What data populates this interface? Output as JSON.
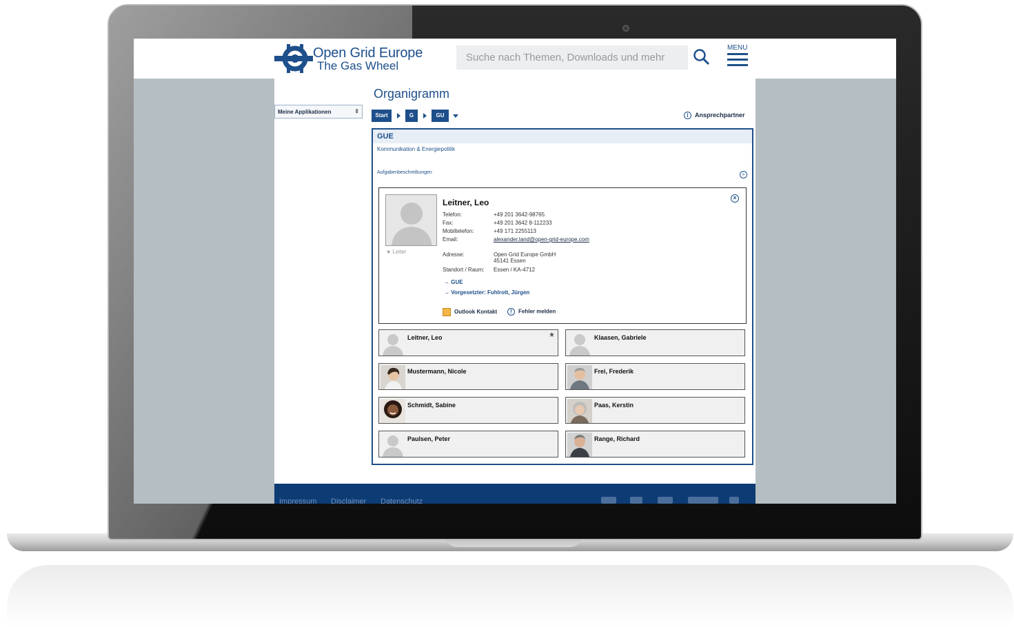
{
  "brand": {
    "line1": "Open Grid Europe",
    "line2": "The Gas Wheel",
    "color": "#1d4f8a"
  },
  "header": {
    "search_placeholder": "Suche nach Themen, Downloads und mehr",
    "menu_label": "MENU"
  },
  "sidebar": {
    "apps_select": "Meine Applikationen"
  },
  "page": {
    "title": "Organigramm",
    "breadcrumb": [
      "Start",
      "G",
      "GU"
    ],
    "contact_link": "Ansprechpartner"
  },
  "unit": {
    "code": "GUE",
    "name": "Kommunikation & Energiepolitik",
    "tasks_link": "Aufgabenbeschreibungen"
  },
  "detail": {
    "name": "Leitner, Leo",
    "role_tag": "Leiter",
    "fields": {
      "phone_label": "Telefon:",
      "phone": "+49 201 3642-98765",
      "fax_label": "Fax:",
      "fax": "+49 201 3642 8-112233",
      "mobile_label": "Mobiltelefon:",
      "mobile": "+49 171 2255113",
      "email_label": "Email:",
      "email": "alexander.land@open-grid-europe.com",
      "address_label": "Adresse:",
      "address_line1": "Open Grid Europe GmbH",
      "address_line2": "45141 Essen",
      "location_label": "Standort / Raum:",
      "location": "Essen / KA-4712"
    },
    "links": {
      "unit": "GUE",
      "supervisor": "Vorgesetzter: Fuhlrott, Jürgen"
    },
    "actions": {
      "outlook": "Outlook Kontakt",
      "report": "Fehler melden"
    }
  },
  "members": [
    {
      "name": "Leitner, Leo",
      "photo": "placeholder-silhouette",
      "lead": true
    },
    {
      "name": "Klaasen, Gabriele",
      "photo": "placeholder-silhouette",
      "lead": false
    },
    {
      "name": "Mustermann, Nicole",
      "photo": "portrait",
      "lead": false
    },
    {
      "name": "Frei, Frederik",
      "photo": "portrait",
      "lead": false
    },
    {
      "name": "Schmidt, Sabine",
      "photo": "portrait",
      "lead": false
    },
    {
      "name": "Paas, Kerstin",
      "photo": "portrait",
      "lead": false
    },
    {
      "name": "Paulsen, Peter",
      "photo": "placeholder-silhouette",
      "lead": false
    },
    {
      "name": "Range, Richard",
      "photo": "portrait",
      "lead": false
    }
  ],
  "footer": {
    "links": [
      "Impressum",
      "Disclaimer",
      "Datenschutz"
    ],
    "social_icons": [
      "facebook-icon",
      "xing-icon",
      "twitter-icon",
      "youtube-icon",
      "rss-icon"
    ]
  }
}
